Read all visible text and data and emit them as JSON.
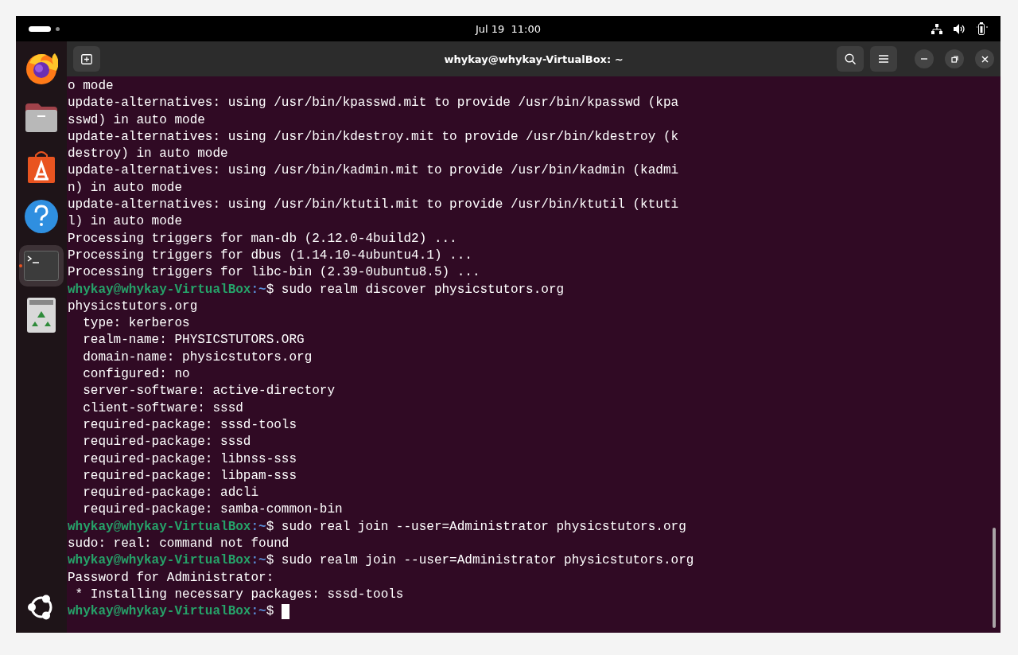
{
  "top_bar": {
    "clock": "Jul 19  11:00"
  },
  "dock": {
    "items": [
      {
        "kind": "firefox",
        "active": false
      },
      {
        "kind": "files",
        "active": false
      },
      {
        "kind": "appcenter",
        "active": false
      },
      {
        "kind": "help",
        "active": false
      },
      {
        "kind": "terminal",
        "active": true
      },
      {
        "kind": "trash",
        "active": false
      }
    ]
  },
  "window": {
    "title": "whykay@whykay-VirtualBox: ~"
  },
  "terminal": {
    "lines": [
      {
        "kind": "out",
        "text": "o mode"
      },
      {
        "kind": "out",
        "text": "update-alternatives: using /usr/bin/kpasswd.mit to provide /usr/bin/kpasswd (kpa"
      },
      {
        "kind": "out",
        "text": "sswd) in auto mode"
      },
      {
        "kind": "out",
        "text": "update-alternatives: using /usr/bin/kdestroy.mit to provide /usr/bin/kdestroy (k"
      },
      {
        "kind": "out",
        "text": "destroy) in auto mode"
      },
      {
        "kind": "out",
        "text": "update-alternatives: using /usr/bin/kadmin.mit to provide /usr/bin/kadmin (kadmi"
      },
      {
        "kind": "out",
        "text": "n) in auto mode"
      },
      {
        "kind": "out",
        "text": "update-alternatives: using /usr/bin/ktutil.mit to provide /usr/bin/ktutil (ktuti"
      },
      {
        "kind": "out",
        "text": "l) in auto mode"
      },
      {
        "kind": "out",
        "text": "Processing triggers for man-db (2.12.0-4build2) ..."
      },
      {
        "kind": "out",
        "text": "Processing triggers for dbus (1.14.10-4ubuntu4.1) ..."
      },
      {
        "kind": "out",
        "text": "Processing triggers for libc-bin (2.39-0ubuntu8.5) ..."
      },
      {
        "kind": "prompt",
        "user": "whykay@whykay-VirtualBox",
        "path": ":~",
        "command": "$ sudo realm discover physicstutors.org"
      },
      {
        "kind": "out",
        "text": "physicstutors.org"
      },
      {
        "kind": "out",
        "text": "  type: kerberos"
      },
      {
        "kind": "out",
        "text": "  realm-name: PHYSICSTUTORS.ORG"
      },
      {
        "kind": "out",
        "text": "  domain-name: physicstutors.org"
      },
      {
        "kind": "out",
        "text": "  configured: no"
      },
      {
        "kind": "out",
        "text": "  server-software: active-directory"
      },
      {
        "kind": "out",
        "text": "  client-software: sssd"
      },
      {
        "kind": "out",
        "text": "  required-package: sssd-tools"
      },
      {
        "kind": "out",
        "text": "  required-package: sssd"
      },
      {
        "kind": "out",
        "text": "  required-package: libnss-sss"
      },
      {
        "kind": "out",
        "text": "  required-package: libpam-sss"
      },
      {
        "kind": "out",
        "text": "  required-package: adcli"
      },
      {
        "kind": "out",
        "text": "  required-package: samba-common-bin"
      },
      {
        "kind": "prompt",
        "user": "whykay@whykay-VirtualBox",
        "path": ":~",
        "command": "$ sudo real join --user=Administrator physicstutors.org"
      },
      {
        "kind": "out",
        "text": "sudo: real: command not found"
      },
      {
        "kind": "prompt",
        "user": "whykay@whykay-VirtualBox",
        "path": ":~",
        "command": "$ sudo realm join --user=Administrator physicstutors.org"
      },
      {
        "kind": "out",
        "text": "Password for Administrator:"
      },
      {
        "kind": "out",
        "text": " * Installing necessary packages: sssd-tools"
      },
      {
        "kind": "prompt",
        "user": "whykay@whykay-VirtualBox",
        "path": ":~",
        "command": "$ ",
        "cursor": true
      }
    ]
  }
}
